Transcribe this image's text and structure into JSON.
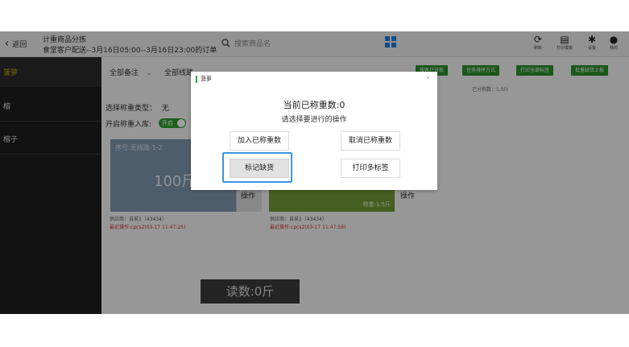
{
  "header": {
    "back_label": "返回",
    "title_line1": "计重商品分拣",
    "title_line2": "食堂客户配送--3月16日05:00--3月16日23:00的订单",
    "search_placeholder": "搜索商品名",
    "tools": [
      {
        "label": "刷新",
        "icon": "refresh-icon",
        "glyph": "⟳"
      },
      {
        "label": "打印模板",
        "icon": "printer-icon",
        "glyph": "▤"
      },
      {
        "label": "设置",
        "icon": "gear-icon",
        "glyph": "✱"
      },
      {
        "label": "我的",
        "icon": "user-icon",
        "glyph": "●"
      }
    ]
  },
  "sidebar": {
    "title": "菠萝",
    "items": [
      "榕",
      "榕子"
    ]
  },
  "filters": {
    "remark": "全部备注",
    "route": "全部线路"
  },
  "action_buttons": [
    "按客户分拣",
    "任务排序方式",
    "打印全部标签",
    "批量缺货上报"
  ],
  "weighed_count": "已分称数：1.5斤",
  "options": {
    "weigh_type_label": "选择称重类型：",
    "weigh_type_value": "无",
    "weigh_in_label": "开启称重入库:",
    "toggle_text": "开启"
  },
  "cards": [
    {
      "seq": "序号:无线路-1-2",
      "amount": "100斤",
      "op": "操作",
      "supplier": "供应商：自采1（43434）",
      "record": "最近操作:cpcs2(03-17 11:47:25)"
    },
    {
      "weight": "称重:1.5斤",
      "op": "操作",
      "supplier": "供应商：自采1（43434）",
      "record": "最近操作:cpcs2(03-17 11:47:59)"
    }
  ],
  "reading": "读数:0斤",
  "dialog": {
    "title": "菠萝",
    "close": "×",
    "count_text": "当前已称重数:0",
    "prompt": "请选择要进行的操作",
    "btn_add": "加入已称重数",
    "btn_cancel": "取消已称重数",
    "btn_mark": "标记缺货",
    "btn_print": "打印多标签"
  },
  "colors": {
    "accent_green": "#2e9b2e",
    "highlight_blue": "#3b96e0",
    "record_red": "#d12a2a",
    "sidebar_title_yellow": "#c6a800"
  }
}
